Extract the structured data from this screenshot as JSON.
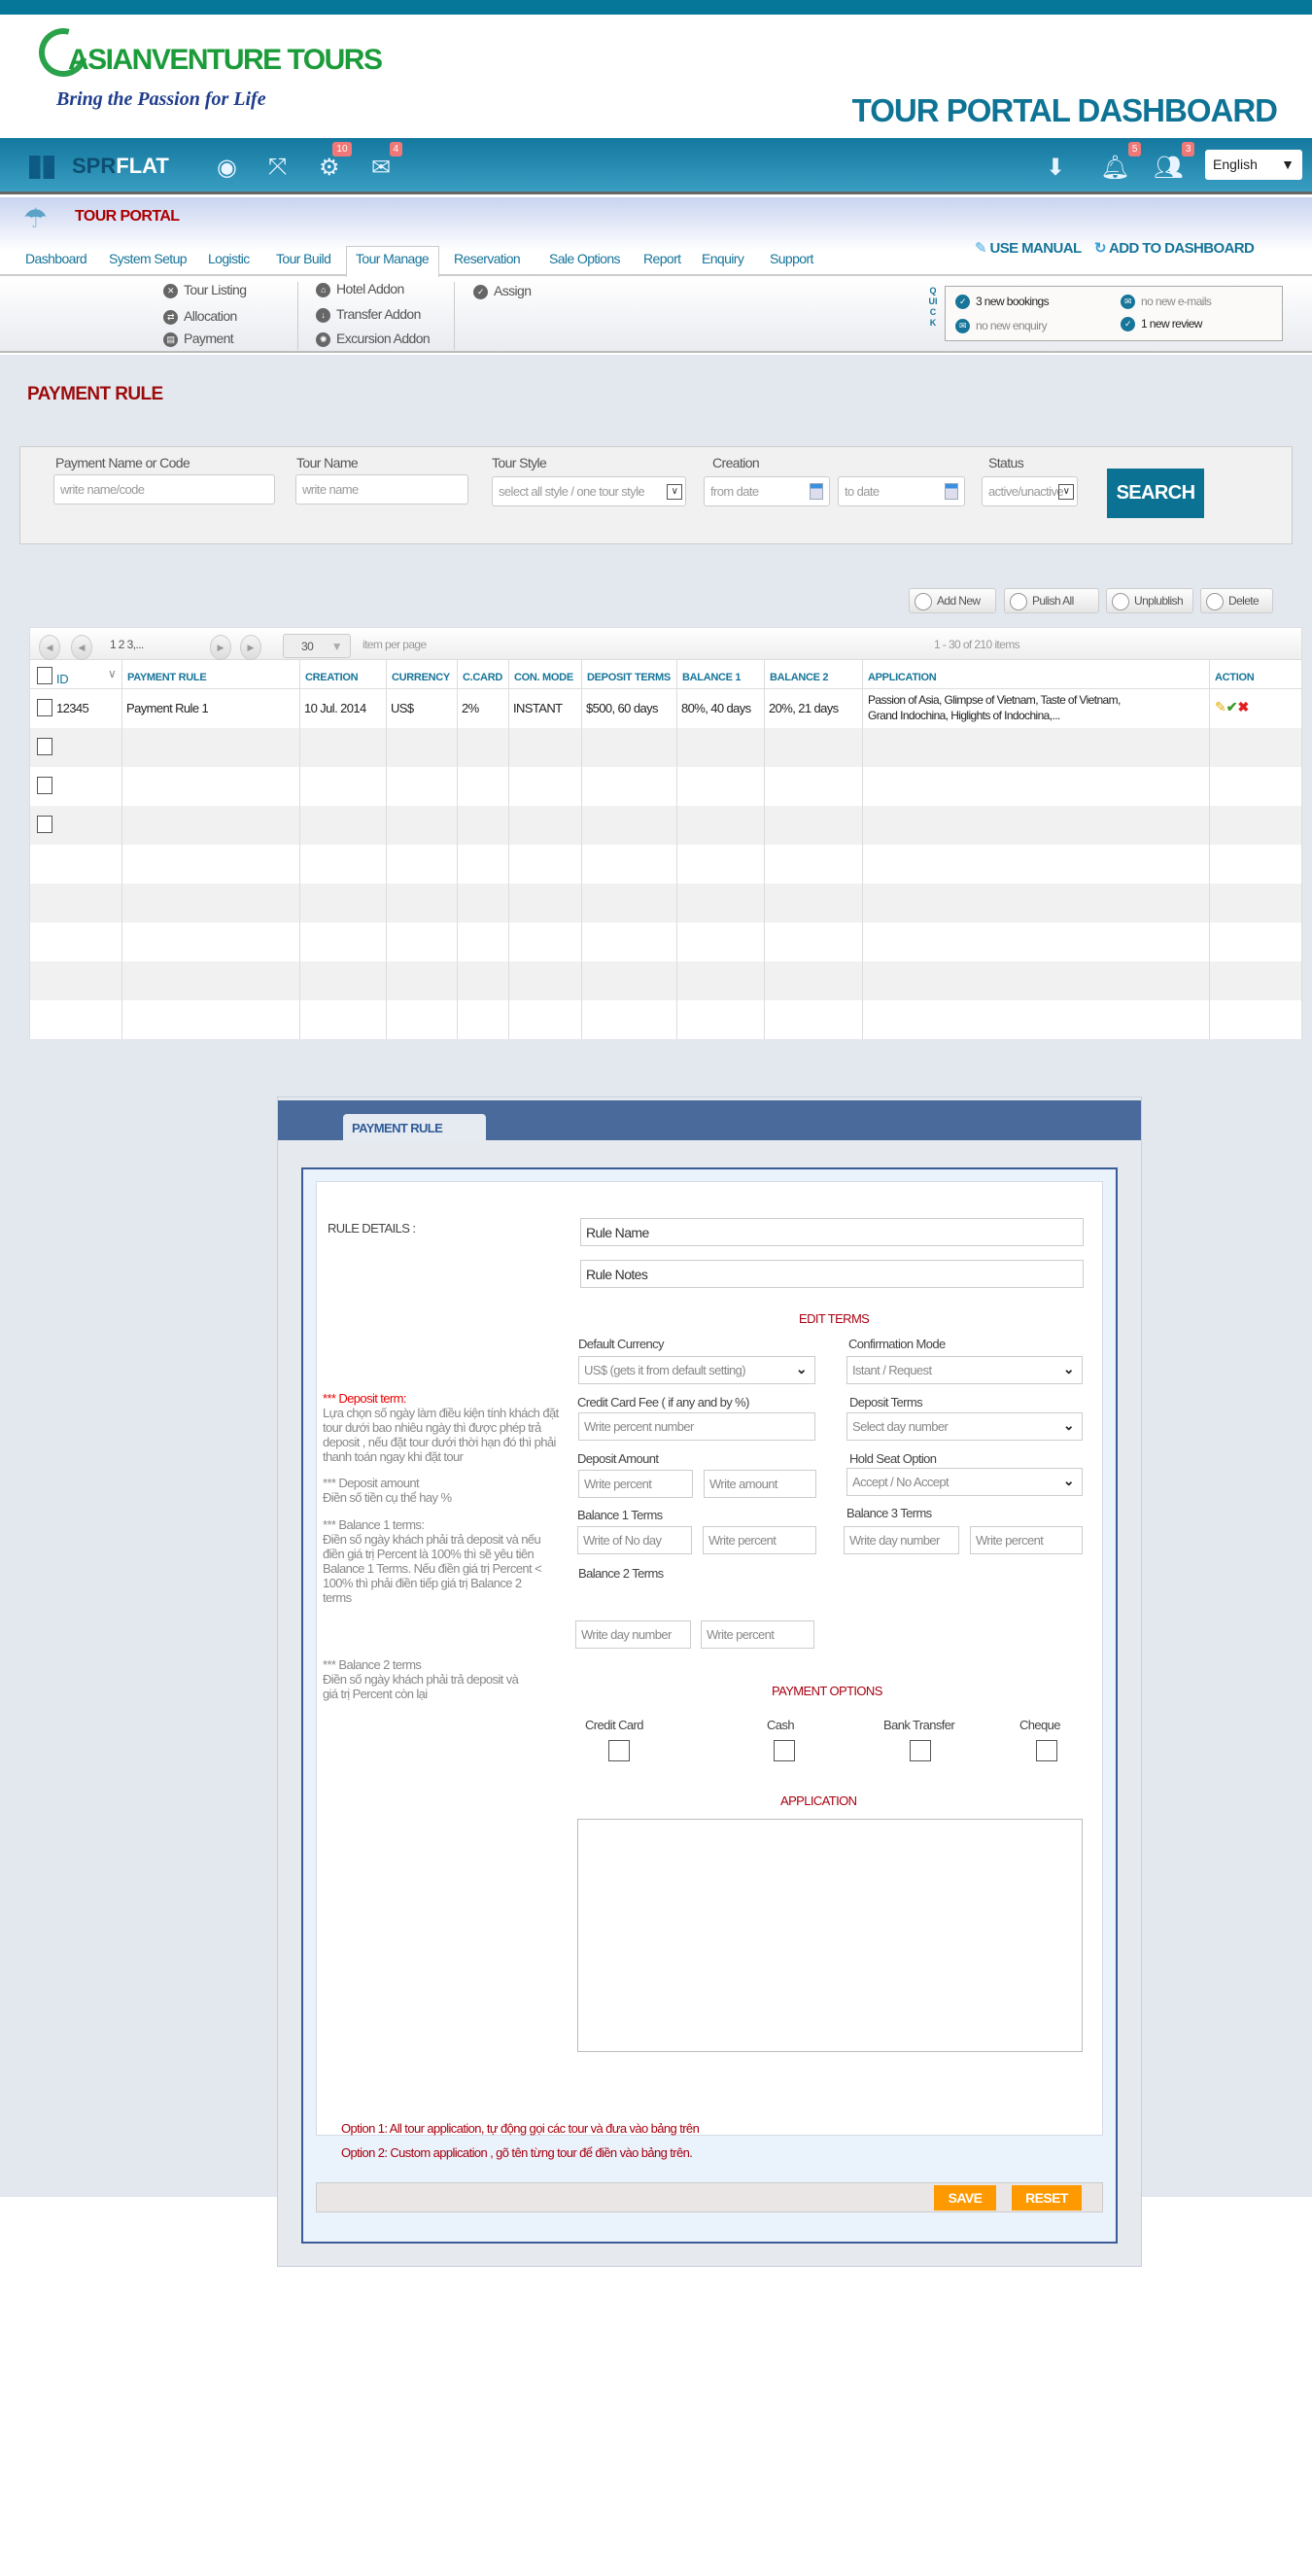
{
  "header": {
    "logo_text": "ASIANVENTURE TOURS",
    "logo_slogan": "Bring the Passion for Life",
    "title": "TOUR PORTAL DASHBOARD"
  },
  "navbar": {
    "brand_a": "SPR",
    "brand_b": "FLAT",
    "settings_badge": "10",
    "mail_badge": "4",
    "bell_badge": "5",
    "users_badge": "3",
    "language": "English"
  },
  "portal": {
    "title": "TOUR PORTAL",
    "use_manual": "USE MANUAL",
    "add_to_dashboard": "ADD TO  DASHBOARD",
    "tabs": [
      "Dashboard",
      "System Setup",
      "Logistic",
      "Tour Build",
      "Tour Manage",
      "Reservation",
      "Sale Options",
      "Report",
      "Enquiry",
      "Support"
    ]
  },
  "submenu": {
    "col1": [
      "Tour Listing",
      "Allocation",
      "Payment"
    ],
    "col2": [
      "Hotel Addon",
      "Transfer Addon",
      "Excursion Addon"
    ],
    "col3": [
      "Assign"
    ]
  },
  "quick": {
    "label": "QUICK",
    "bookings": "3 new bookings",
    "emails": "no new e-mails",
    "enquiry": "no new enquiry",
    "review": "1 new review"
  },
  "page_title": "PAYMENT RULE",
  "filter": {
    "name_label": "Payment Name or Code",
    "name_placeholder": "write name/code",
    "tour_label": "Tour Name",
    "tour_placeholder": "write name",
    "style_label": "Tour  Style",
    "style_value": "select all style / one tour style",
    "creation_label": "Creation",
    "from_placeholder": "from date",
    "to_placeholder": "to date",
    "status_label": "Status",
    "status_value": "active/unactive",
    "search": "SEARCH"
  },
  "actions": {
    "add_new": "Add New",
    "publish_all": "Pulish All",
    "unpublish": "Unplublish",
    "delete": "Delete"
  },
  "grid": {
    "pages": "1  2  3,...",
    "per_page": "30",
    "per_page_label": "item per page",
    "range": "1 - 30  of 210 items",
    "columns": [
      "ID",
      "PAYMENT RULE",
      "CREATION",
      "CURRENCY",
      "C.CARD",
      "CON. MODE",
      "DEPOSIT TERMS",
      "BALANCE 1",
      "BALANCE 2",
      "APPLICATION",
      "ACTION"
    ],
    "rows": [
      {
        "id": "12345",
        "rule": "Payment Rule 1",
        "creation": "10 Jul. 2014",
        "currency": "US$",
        "ccard": "2%",
        "mode": "INSTANT",
        "deposit": "$500, 60 days",
        "bal1": "80%, 40 days",
        "bal2": "20%,  21 days",
        "app1": "Passion of Asia,  Glimpse of Vietnam, Taste of Vietnam,",
        "app2": " Grand Indochina, Higlights of Indochina,..."
      }
    ]
  },
  "form": {
    "tab": "PAYMENT RULE",
    "rule_details": "RULE DETAILS :",
    "rule_name": "Rule Name",
    "rule_notes": "Rule Notes",
    "edit_terms": "EDIT TERMS",
    "default_currency_label": "Default Currency",
    "default_currency_value": "US$   (gets it from  default setting)",
    "confirmation_label": "Confirmation Mode",
    "confirmation_value": "Istant / Request",
    "ccfee_label": "Credit Card Fee ( if any and by %)",
    "ccfee_placeholder": "Write percent number",
    "deposit_terms_label": "Deposit Terms",
    "deposit_terms_value": "Select day number",
    "deposit_amount_label": "Deposit  Amount",
    "deposit_percent_ph": "Write  percent",
    "deposit_amount_ph": "Write amount",
    "hold_seat_label": "Hold Seat Option",
    "hold_seat_value": "Accept / No Accept",
    "bal1_label": "Balance 1 Terms",
    "bal1_day_ph": "  Write  of No day",
    "bal1_pct_ph": "Write percent",
    "bal3_label": "Balance 3 Terms",
    "bal3_day_ph": "Write  day number",
    "bal3_pct_ph": "Write percent",
    "bal2_label": "Balance 2 Terms",
    "bal2_day_ph": "Write  day number",
    "bal2_pct_ph": "Write percent",
    "notes": {
      "deposit_term_title": "*** Deposit term:",
      "deposit_term_text": "Lựa chọn số ngày làm điều kiện tính khách đặt tour dưới bao nhiêu ngày thì được phép trả deposit , nếu đặt tour  dưới thời hạn đó thì phải thanh toán ngay khi đặt tour",
      "deposit_amount_title": "*** Deposit amount",
      "deposit_amount_text": "Điền số tiền  cụ thể hay %",
      "balance1_title": "*** Balance  1 terms:",
      "balance1_text": "Điền số ngày khách phải trả deposit và nếu điền giá trị Percent là 100% thì sẽ yêu tiên Balance 1 Terms. Nếu điền giá trị Percent < 100% thì phải điền tiếp giá trị Balance 2 terms",
      "balance2_title": "*** Balance 2 terms",
      "balance2_text": "Điền số ngày khách phải trả deposit và giá trị Percent  còn lại"
    },
    "payment_options": "PAYMENT OPTIONS",
    "options": [
      "Credit Card",
      "Cash",
      "Bank Transfer",
      "Cheque"
    ],
    "application": "APPLICATION",
    "option1": "Option 1: All tour application, tự động gọi các tour và đưa vào bảng trên",
    "option2": "Option 2: Custom application , gõ tên từng tour để điền vào bảng trên.",
    "save": "SAVE",
    "reset": "RESET"
  },
  "colors": {
    "brand": "#077799",
    "accent_red": "#a80010",
    "orange": "#ff9900",
    "panel_blue": "#4a6a9b"
  }
}
